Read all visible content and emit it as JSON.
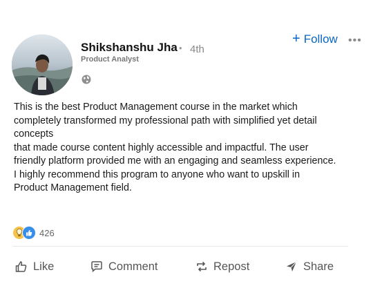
{
  "author": {
    "name": "Shikshanshu Jha",
    "degree": "4th",
    "headline": "Product Analyst"
  },
  "follow_label": "Follow",
  "post_lines": [
    "This is the best Product Management course in the market which",
    "completely transformed my professional path with simplified yet detail",
    "concepts",
    "that made course content highly accessible and impactful. The user",
    "friendly platform provided me with an engaging and seamless experience.",
    "I highly recommend this program to anyone who want to upskill in",
    "Product Management field."
  ],
  "reactions": {
    "count": "426",
    "types": [
      "insightful-icon",
      "like-icon"
    ]
  },
  "actions": {
    "like": "Like",
    "comment": "Comment",
    "repost": "Repost",
    "share": "Share"
  },
  "colors": {
    "accent": "#0a66c2",
    "text": "#1a1a1a",
    "muted": "#666666"
  }
}
